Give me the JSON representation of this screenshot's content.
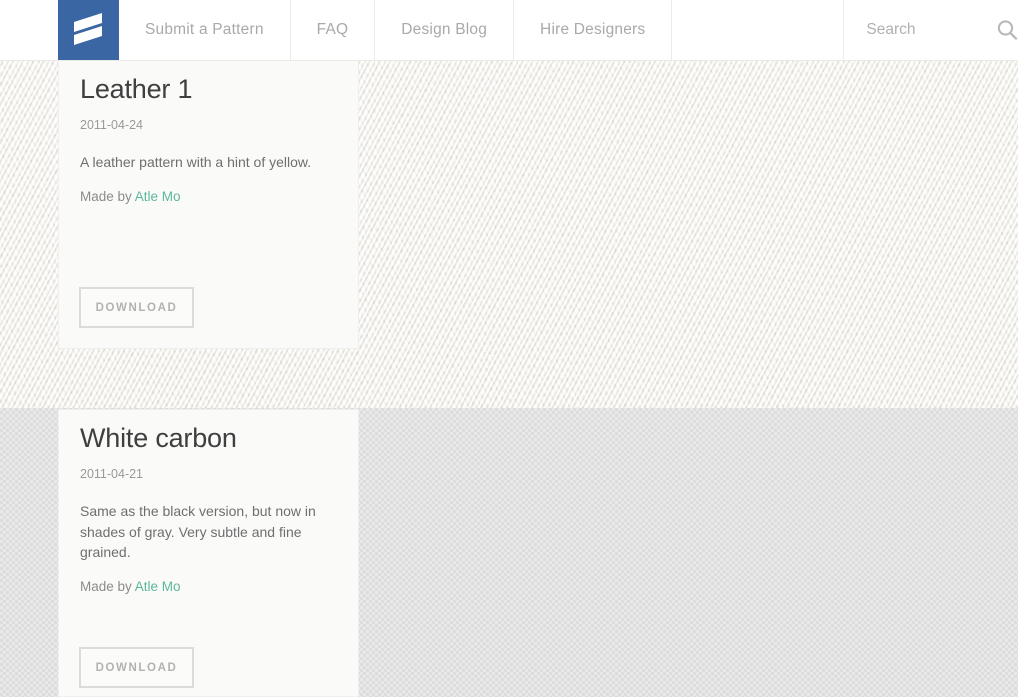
{
  "site": {
    "logo_icon": "subtle-patterns-stripes-logo",
    "logo_color": "#3a66a3"
  },
  "nav": {
    "items": [
      {
        "label": "Submit a Pattern",
        "name": "submit-a-pattern"
      },
      {
        "label": "FAQ",
        "name": "faq"
      },
      {
        "label": "Design Blog",
        "name": "design-blog"
      },
      {
        "label": "Hire Designers",
        "name": "hire-designers"
      }
    ],
    "search": {
      "placeholder": "Search",
      "value": "",
      "icon": "search-icon"
    }
  },
  "patterns": [
    {
      "title": "Leather 1",
      "date": "2011-04-24",
      "description": "A leather pattern with a hint of yellow.",
      "made_by_label": "Made by",
      "author": "Atle Mo",
      "download_label": "DOWNLOAD",
      "preview_texture": "leather",
      "preview_color": "#f4f2ec"
    },
    {
      "title": "White carbon",
      "date": "2011-04-21",
      "description": "Same as the black version, but now in shades of gray. Very subtle and fine grained.",
      "made_by_label": "Made by",
      "author": "Atle Mo",
      "download_label": "DOWNLOAD",
      "preview_texture": "carbon",
      "preview_color": "#e3e3e3"
    }
  ],
  "colors": {
    "brand_blue": "#3a66a3",
    "link_green": "#5cb79a",
    "nav_text": "#a9a9a9",
    "title_text": "#3f3f3f",
    "body_text": "#6f6f6f",
    "button_border": "#dcdbd8",
    "button_text": "#b3b2af"
  }
}
